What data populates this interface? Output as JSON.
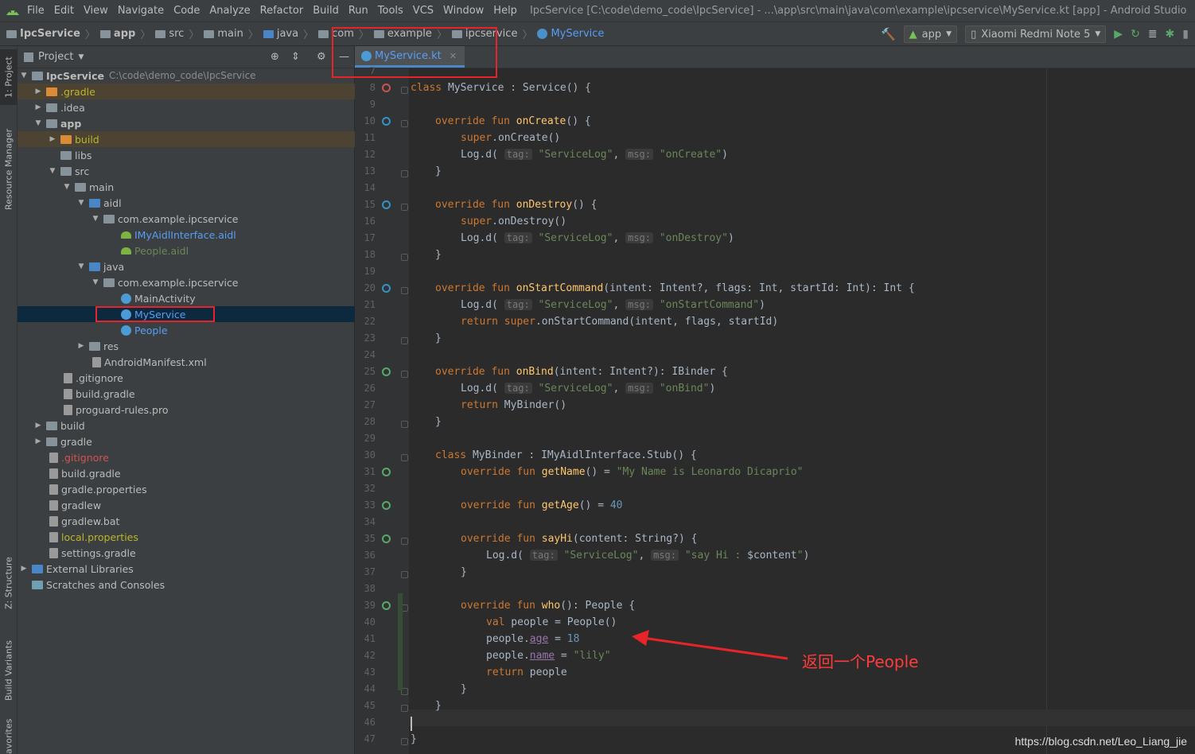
{
  "menu": {
    "items": [
      "File",
      "Edit",
      "View",
      "Navigate",
      "Code",
      "Analyze",
      "Refactor",
      "Build",
      "Run",
      "Tools",
      "VCS",
      "Window",
      "Help"
    ],
    "window_title": "IpcService [C:\\code\\demo_code\\IpcService] - ...\\app\\src\\main\\java\\com\\example\\ipcservice\\MyService.kt [app] - Android Studio"
  },
  "breadcrumbs": [
    "IpcService",
    "app",
    "src",
    "main",
    "java",
    "com",
    "example",
    "ipcservice",
    "MyService"
  ],
  "toolbar": {
    "run_config": "app",
    "device": "Xiaomi Redmi Note 5"
  },
  "side_tabs": {
    "project": "1: Project",
    "resource_manager": "Resource Manager",
    "structure": "Z: Structure",
    "build_variants": "Build Variants",
    "favorites": "avorites"
  },
  "project_panel": {
    "title": "Project",
    "tree": [
      {
        "label": "IpcService",
        "extra": "C:\\code\\demo_code\\IpcService"
      },
      {
        "label": ".gradle"
      },
      {
        "label": ".idea"
      },
      {
        "label": "app"
      },
      {
        "label": "build"
      },
      {
        "label": "libs"
      },
      {
        "label": "src"
      },
      {
        "label": "main"
      },
      {
        "label": "aidl"
      },
      {
        "label": "com.example.ipcservice"
      },
      {
        "label": "IMyAidlInterface.aidl"
      },
      {
        "label": "People.aidl"
      },
      {
        "label": "java"
      },
      {
        "label": "com.example.ipcservice"
      },
      {
        "label": "MainActivity"
      },
      {
        "label": "MyService"
      },
      {
        "label": "People"
      },
      {
        "label": "res"
      },
      {
        "label": "AndroidManifest.xml"
      },
      {
        "label": ".gitignore"
      },
      {
        "label": "build.gradle"
      },
      {
        "label": "proguard-rules.pro"
      },
      {
        "label": "build"
      },
      {
        "label": "gradle"
      },
      {
        "label": ".gitignore"
      },
      {
        "label": "build.gradle"
      },
      {
        "label": "gradle.properties"
      },
      {
        "label": "gradlew"
      },
      {
        "label": "gradlew.bat"
      },
      {
        "label": "local.properties"
      },
      {
        "label": "settings.gradle"
      },
      {
        "label": "External Libraries"
      },
      {
        "label": "Scratches and Consoles"
      }
    ]
  },
  "editor": {
    "tab_label": "MyService.kt",
    "line_numbers": [
      "7",
      "8",
      "9",
      "10",
      "11",
      "12",
      "13",
      "14",
      "15",
      "16",
      "17",
      "18",
      "19",
      "20",
      "21",
      "22",
      "23",
      "24",
      "25",
      "26",
      "27",
      "28",
      "29",
      "30",
      "31",
      "32",
      "33",
      "34",
      "35",
      "36",
      "37",
      "38",
      "39",
      "40",
      "41",
      "42",
      "43",
      "44",
      "45",
      "46",
      "47"
    ],
    "hints": {
      "tag": "tag:",
      "msg": "msg:"
    },
    "tokens": {
      "class_kw": "class",
      "class_name": "MyService",
      "service": " : Service() {",
      "override_fun": "override fun ",
      "onCreate": "onCreate",
      "onDestroy": "onDestroy",
      "onStartCommand": "onStartCommand",
      "onBind": "onBind",
      "getName": "getName",
      "getAge": "getAge",
      "sayHi": "sayHi",
      "who": "who",
      "super_call": "super",
      "log_d": "Log.d(",
      "s_servicelog": "\"ServiceLog\"",
      "s_oncreate": "\"onCreate\"",
      "s_ondestroy": "\"onDestroy\"",
      "s_onstart": "\"onStartCommand\"",
      "s_onbind": "\"onBind\"",
      "s_name": "\"My Name is Leonardo Dicaprio\"",
      "n_40": "40",
      "n_18": "18",
      "s_sayhi": "\"say Hi : ",
      "content_var": "$content",
      "s_lily": "\"lily\"",
      "return_kw": "return",
      "val_kw": "val",
      "start_params": "(intent: Intent?, flags: Int, startId: Int): Int {",
      "start_ret": "onStartCommand(intent, flags, startId)",
      "bind_params": "(intent: Intent?): IBinder {",
      "mybinder_call": "MyBinder()",
      "mybinder_class": "MyBinder",
      "stub": " : IMyAidlInterface.Stub() {",
      "sayhi_params": "(content: String?) {",
      "who_sig": "(): People {",
      "people_decl": " people = People()",
      "people_age_pre": "people.",
      "age": "age",
      "name": "name",
      "eq": " = ",
      "return_people": " people"
    }
  },
  "annotation": {
    "text": "返回一个People"
  },
  "watermark": "https://blog.csdn.net/Leo_Liang_jie",
  "colors": {
    "keyword": "#cc7832",
    "function": "#ffc66d",
    "string": "#6a8759",
    "number": "#6897bb",
    "property": "#9876aa",
    "annotation_red": "#e8242b"
  }
}
